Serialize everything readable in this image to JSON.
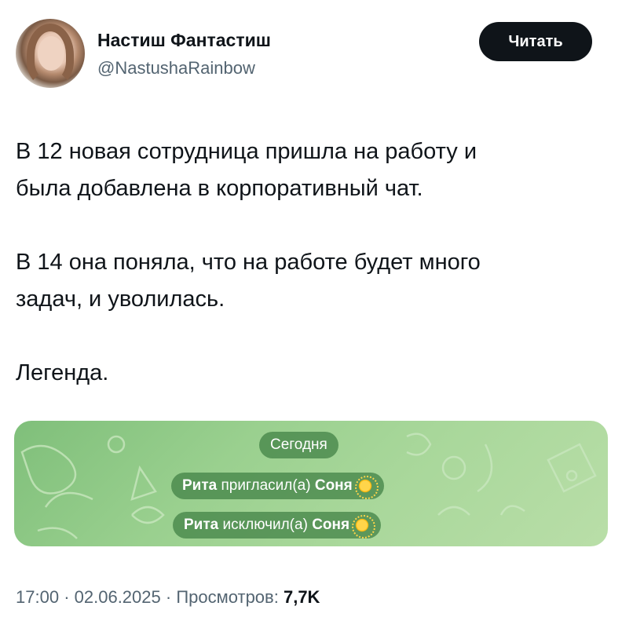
{
  "tweet": {
    "author_name": "Настиш Фантастиш",
    "author_handle": "@NastushaRainbow",
    "read_button": "Читать",
    "lines": [
      "В 12 новая сотрудница пришла на работу и",
      "была добавлена в корпоративный чат.",
      "В 14 она поняла, что на работе будет много",
      "задач, и уволилась.",
      "Легенда."
    ]
  },
  "chat": {
    "date_label": "Сегодня",
    "events": [
      {
        "actor": "Рита",
        "action": "пригласил(а)",
        "target": "Соня"
      },
      {
        "actor": "Рита",
        "action": "исключил(а)",
        "target": "Соня"
      }
    ],
    "background_color": "#9ad08f"
  },
  "meta": {
    "time": "17:00",
    "date": "02.06.2025",
    "views_label": "Просмотров:",
    "views_count": "7,7K",
    "separator": "·"
  }
}
